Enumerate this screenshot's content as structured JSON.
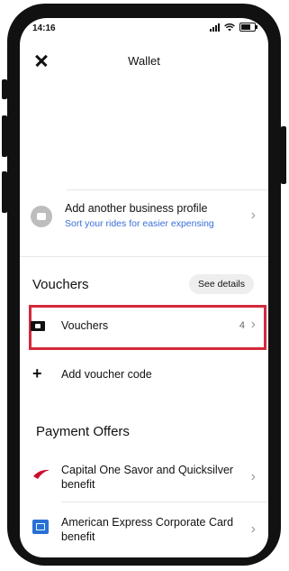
{
  "status_bar": {
    "time": "14:16",
    "battery_level": 0.8
  },
  "header": {
    "title": "Wallet"
  },
  "business": {
    "title": "Add another business profile",
    "subtitle": "Sort your rides for easier expensing"
  },
  "vouchers": {
    "heading": "Vouchers",
    "see_details": "See details",
    "item_label": "Vouchers",
    "item_count": "4",
    "add_code": "Add voucher code"
  },
  "payment_offers": {
    "heading": "Payment Offers",
    "items": [
      {
        "line1": "Capital One Savor and Quicksilver",
        "line2": "benefit"
      },
      {
        "line1": "American Express Corporate Card",
        "line2": "benefit"
      }
    ]
  },
  "colors": {
    "highlight": "#d4283c",
    "link": "#3a6fd8",
    "capital_one": "#c8102e",
    "amex": "#2a6fd6"
  }
}
